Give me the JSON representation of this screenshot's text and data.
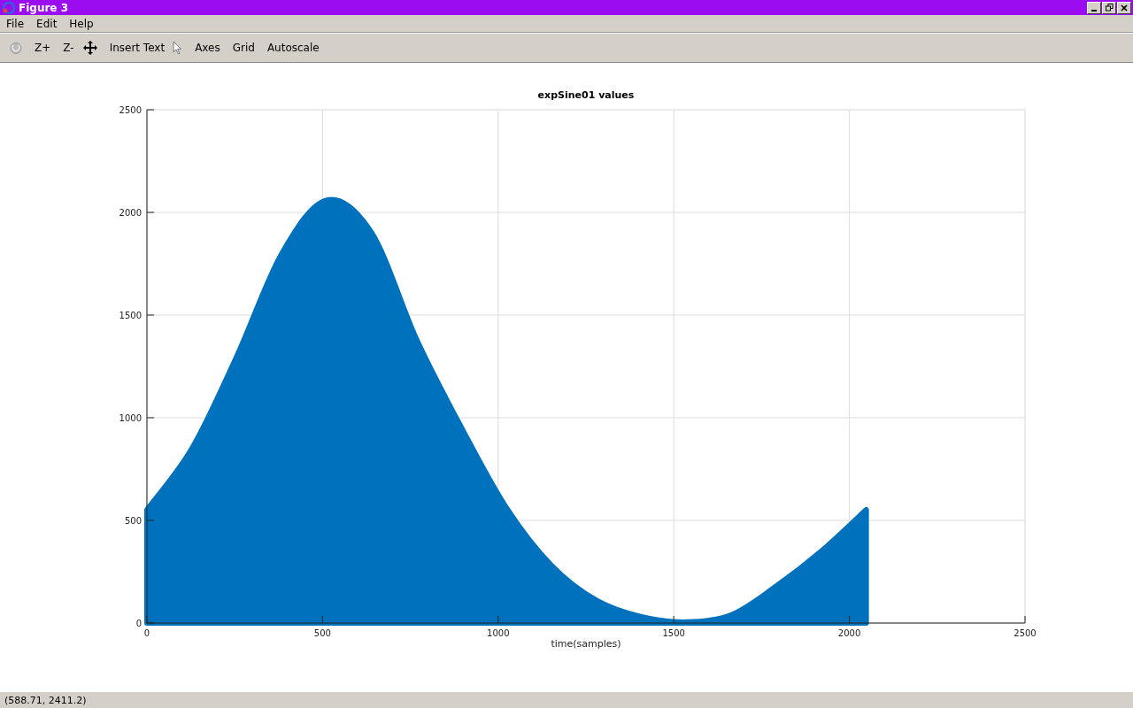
{
  "window": {
    "title": "Figure 3"
  },
  "menu": [
    "File",
    "Edit",
    "Help"
  ],
  "toolbar": {
    "buttons": [
      "Z+",
      "Z-",
      "Insert Text",
      "Axes",
      "Grid",
      "Autoscale"
    ]
  },
  "plot": {
    "chart_data": {
      "type": "area",
      "title": "expSine01 values",
      "xlabel": "time(samples)",
      "x": [
        0,
        128,
        256,
        384,
        512,
        640,
        768,
        896,
        1024,
        1152,
        1280,
        1408,
        1536,
        1664,
        1792,
        1920,
        2048
      ],
      "grid": true,
      "series": [
        {
          "color": "#0072bd",
          "values": [
            552,
            850,
            1300,
            1800,
            2060,
            1900,
            1380,
            950,
            560,
            280,
            110,
            30,
            5,
            40,
            180,
            350,
            552
          ]
        }
      ],
      "xlim": [
        0,
        2500
      ],
      "ylim": [
        0,
        2500
      ],
      "xticks": [
        0,
        500,
        1000,
        1500,
        2000,
        2500
      ],
      "yticks": [
        0,
        500,
        1000,
        1500,
        2000,
        2500
      ]
    }
  },
  "status_bar": {
    "text": "(588.71, 2411.2)"
  }
}
